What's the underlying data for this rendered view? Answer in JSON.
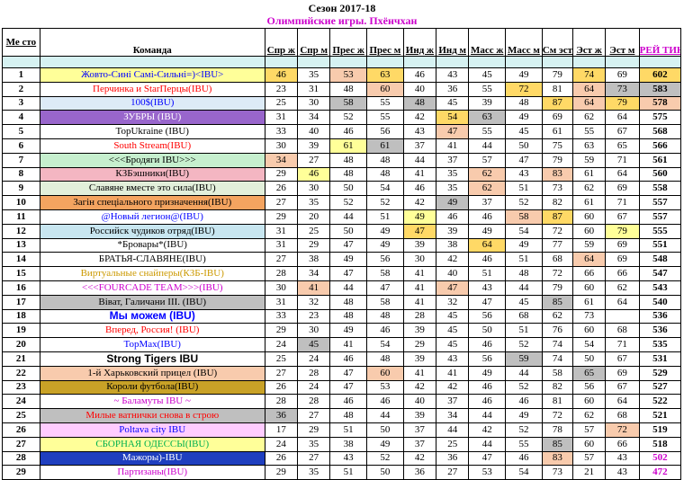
{
  "title": "Сезон 2017-18",
  "subtitle": "Олимпийские игры. Пхёнчхан",
  "headers": {
    "place": "Ме сто",
    "team": "Команда",
    "cols": [
      "Спр ж",
      "Спр м",
      "Прес ж",
      "Прес м",
      "Инд ж",
      "Инд м",
      "Масс ж",
      "Масс м",
      "См эст",
      "Эст ж",
      "Эст м"
    ],
    "rating": "РЕЙ ТИНГ"
  },
  "colors": {
    "yellow": "#ffff99",
    "peach": "#f8cbad",
    "gold": "#ffd966",
    "grey": "#bfbfbf",
    "light_blue": "#ddebf7",
    "spacer": "#d6f2f2"
  },
  "rows": [
    {
      "place": "1",
      "team": "Жовто-Сині Самі-Сильні=)<IBU>",
      "team_color": "#0000ff",
      "team_bg": "#ffff99",
      "team_bold": false,
      "values": [
        "46",
        "35",
        "53",
        "63",
        "46",
        "43",
        "45",
        "49",
        "79",
        "74",
        "69"
      ],
      "rating": "602",
      "rating_color": "#000000",
      "bg": [
        "#ffd966",
        "",
        "#f8cbad",
        "#ffd966",
        "",
        "",
        "",
        "",
        "",
        "#ffd966",
        ""
      ],
      "rating_bg": "#ffd966"
    },
    {
      "place": "2",
      "team": "Перчинка и StarПерцы(IBU)",
      "team_color": "#ff0000",
      "team_bg": "",
      "team_bold": false,
      "values": [
        "23",
        "31",
        "48",
        "60",
        "40",
        "36",
        "55",
        "72",
        "81",
        "64",
        "73"
      ],
      "rating": "583",
      "rating_color": "#000000",
      "bg": [
        "",
        "",
        "",
        "#f8cbad",
        "",
        "",
        "",
        "#ffd966",
        "",
        "#f8cbad",
        "#bfbfbf"
      ],
      "rating_bg": "#bfbfbf"
    },
    {
      "place": "3",
      "team": "100$(IBU)",
      "team_color": "#0000ff",
      "team_bg": "#ddebf7",
      "team_bold": false,
      "values": [
        "25",
        "30",
        "58",
        "55",
        "48",
        "45",
        "39",
        "48",
        "87",
        "64",
        "79"
      ],
      "rating": "578",
      "rating_color": "#000000",
      "bg": [
        "",
        "",
        "#bfbfbf",
        "",
        "#bfbfbf",
        "",
        "",
        "",
        "#ffd966",
        "#f8cbad",
        "#ffd966"
      ],
      "rating_bg": "#f8cbad"
    },
    {
      "place": "4",
      "team": "ЗУБРЫ (IBU)",
      "team_color": "#ffffff",
      "team_bg": "#9966cc",
      "team_bold": false,
      "values": [
        "31",
        "34",
        "52",
        "55",
        "42",
        "54",
        "63",
        "49",
        "69",
        "62",
        "64"
      ],
      "rating": "575",
      "rating_color": "#000000",
      "bg": [
        "",
        "",
        "",
        "",
        "",
        "#ffd966",
        "#bfbfbf",
        "",
        "",
        "",
        ""
      ],
      "rating_bg": ""
    },
    {
      "place": "5",
      "team": "TopUkraine (IBU)",
      "team_color": "#000000",
      "team_bg": "",
      "team_bold": false,
      "values": [
        "33",
        "40",
        "46",
        "56",
        "43",
        "47",
        "55",
        "45",
        "61",
        "55",
        "67"
      ],
      "rating": "568",
      "rating_color": "#000000",
      "bg": [
        "",
        "",
        "",
        "",
        "",
        "#f8cbad",
        "",
        "",
        "",
        "",
        ""
      ],
      "rating_bg": ""
    },
    {
      "place": "6",
      "team": "South Stream(IBU)",
      "team_color": "#ff0000",
      "team_bg": "",
      "team_bold": false,
      "values": [
        "30",
        "39",
        "61",
        "61",
        "37",
        "41",
        "44",
        "50",
        "75",
        "63",
        "65"
      ],
      "rating": "566",
      "rating_color": "#000000",
      "bg": [
        "",
        "",
        "#ffff99",
        "#bfbfbf",
        "",
        "",
        "",
        "",
        "",
        "",
        ""
      ],
      "rating_bg": ""
    },
    {
      "place": "7",
      "team": "<<<Бродяги IBU>>>",
      "team_color": "#000000",
      "team_bg": "#c6efce",
      "team_bold": false,
      "values": [
        "34",
        "27",
        "48",
        "48",
        "44",
        "37",
        "57",
        "47",
        "79",
        "59",
        "71"
      ],
      "rating": "561",
      "rating_color": "#000000",
      "bg": [
        "#f8cbad",
        "",
        "",
        "",
        "",
        "",
        "",
        "",
        "",
        "",
        ""
      ],
      "rating_bg": ""
    },
    {
      "place": "8",
      "team": "КЗБэшники(IBU)",
      "team_color": "#000000",
      "team_bg": "#f4b6c2",
      "team_bold": false,
      "values": [
        "29",
        "46",
        "48",
        "48",
        "41",
        "35",
        "62",
        "43",
        "83",
        "61",
        "64"
      ],
      "rating": "560",
      "rating_color": "#000000",
      "bg": [
        "",
        "#ffff99",
        "",
        "",
        "",
        "",
        "#f8cbad",
        "",
        "#f8cbad",
        "",
        ""
      ],
      "rating_bg": ""
    },
    {
      "place": "9",
      "team": "Славяне вместе это сила(IBU)",
      "team_color": "#000000",
      "team_bg": "#e2efda",
      "team_bold": false,
      "values": [
        "26",
        "30",
        "50",
        "54",
        "46",
        "35",
        "62",
        "51",
        "73",
        "62",
        "69"
      ],
      "rating": "558",
      "rating_color": "#000000",
      "bg": [
        "",
        "",
        "",
        "",
        "",
        "",
        "#f8cbad",
        "",
        "",
        "",
        ""
      ],
      "rating_bg": ""
    },
    {
      "place": "10",
      "team": "Загін спеціального призначення(IBU)",
      "team_color": "#000000",
      "team_bg": "#f4a460",
      "team_bold": false,
      "values": [
        "27",
        "35",
        "52",
        "52",
        "42",
        "49",
        "37",
        "52",
        "82",
        "61",
        "71"
      ],
      "rating": "557",
      "rating_color": "#000000",
      "bg": [
        "",
        "",
        "",
        "",
        "",
        "#bfbfbf",
        "",
        "",
        "",
        "",
        ""
      ],
      "rating_bg": ""
    },
    {
      "place": "11",
      "team": "@Новый легион@(IBU)",
      "team_color": "#0000ff",
      "team_bg": "",
      "team_bold": false,
      "values": [
        "29",
        "20",
        "44",
        "51",
        "49",
        "46",
        "46",
        "58",
        "87",
        "60",
        "67"
      ],
      "rating": "557",
      "rating_color": "#000000",
      "bg": [
        "",
        "",
        "",
        "",
        "#ffff99",
        "",
        "",
        "#f8cbad",
        "#ffd966",
        "",
        ""
      ],
      "rating_bg": ""
    },
    {
      "place": "12",
      "team": "Российск чудиков отряд(IBU)",
      "team_color": "#000000",
      "team_bg": "#c8e6f0",
      "team_bold": false,
      "values": [
        "31",
        "25",
        "50",
        "49",
        "47",
        "39",
        "49",
        "54",
        "72",
        "60",
        "79"
      ],
      "rating": "555",
      "rating_color": "#000000",
      "bg": [
        "",
        "",
        "",
        "",
        "#ffd966",
        "",
        "",
        "",
        "",
        "",
        "#ffff99"
      ],
      "rating_bg": ""
    },
    {
      "place": "13",
      "team": "*Бровары*(IBU)",
      "team_color": "#000000",
      "team_bg": "",
      "team_bold": false,
      "values": [
        "31",
        "29",
        "47",
        "49",
        "39",
        "38",
        "64",
        "49",
        "77",
        "59",
        "69"
      ],
      "rating": "551",
      "rating_color": "#000000",
      "bg": [
        "",
        "",
        "",
        "",
        "",
        "",
        "#ffd966",
        "",
        "",
        "",
        ""
      ],
      "rating_bg": ""
    },
    {
      "place": "14",
      "team": "БРАТЬЯ-СЛАВЯНЕ(IBU)",
      "team_color": "#000000",
      "team_bg": "",
      "team_bold": false,
      "values": [
        "27",
        "38",
        "49",
        "56",
        "30",
        "42",
        "46",
        "51",
        "68",
        "64",
        "69"
      ],
      "rating": "548",
      "rating_color": "#000000",
      "bg": [
        "",
        "",
        "",
        "",
        "",
        "",
        "",
        "",
        "",
        "#f8cbad",
        ""
      ],
      "rating_bg": ""
    },
    {
      "place": "15",
      "team": "Виртуальные снайперы(КЗБ-IBU)",
      "team_color": "#cc9900",
      "team_bg": "",
      "team_bold": false,
      "values": [
        "28",
        "34",
        "47",
        "58",
        "41",
        "40",
        "51",
        "48",
        "72",
        "66",
        "66"
      ],
      "rating": "547",
      "rating_color": "#000000",
      "bg": [
        "",
        "",
        "",
        "",
        "",
        "",
        "",
        "",
        "",
        "",
        ""
      ],
      "rating_bg": ""
    },
    {
      "place": "16",
      "team": "<<<FOURCADE TEAM>>>(IBU)",
      "team_color": "#cc00cc",
      "team_bg": "",
      "team_bold": false,
      "values": [
        "30",
        "41",
        "44",
        "47",
        "41",
        "47",
        "43",
        "44",
        "79",
        "60",
        "62"
      ],
      "rating": "543",
      "rating_color": "#000000",
      "bg": [
        "",
        "#f8cbad",
        "",
        "",
        "",
        "#f8cbad",
        "",
        "",
        "",
        "",
        ""
      ],
      "rating_bg": ""
    },
    {
      "place": "17",
      "team": "Віват, Галичани ІІІ. (IBU)",
      "team_color": "#000000",
      "team_bg": "#bfbfbf",
      "team_bold": false,
      "values": [
        "31",
        "32",
        "48",
        "58",
        "41",
        "32",
        "47",
        "45",
        "85",
        "61",
        "64"
      ],
      "rating": "540",
      "rating_color": "#000000",
      "bg": [
        "",
        "",
        "",
        "",
        "",
        "",
        "",
        "",
        "#bfbfbf",
        "",
        ""
      ],
      "rating_bg": ""
    },
    {
      "place": "18",
      "team": "Мы можем (IBU)",
      "team_color": "#0000ff",
      "team_bg": "",
      "team_bold": true,
      "values": [
        "33",
        "23",
        "48",
        "48",
        "28",
        "45",
        "56",
        "68",
        "62",
        "73",
        ""
      ],
      "rating": "536",
      "rating_color": "#000000",
      "bg": [
        "",
        "",
        "",
        "",
        "",
        "",
        "",
        "",
        "",
        "",
        ""
      ],
      "rating_bg": ""
    },
    {
      "place": "19",
      "team": "Вперед, Россия! (IBU)",
      "team_color": "#ff0000",
      "team_bg": "",
      "team_bold": false,
      "values": [
        "29",
        "30",
        "49",
        "46",
        "39",
        "45",
        "50",
        "51",
        "76",
        "60",
        "68"
      ],
      "rating": "536",
      "rating_color": "#000000",
      "bg": [
        "",
        "",
        "",
        "",
        "",
        "",
        "",
        "",
        "",
        "",
        ""
      ],
      "rating_bg": ""
    },
    {
      "place": "20",
      "team": "TopMax(IBU)",
      "team_color": "#0000ff",
      "team_bg": "",
      "team_bold": false,
      "values": [
        "24",
        "45",
        "41",
        "54",
        "29",
        "45",
        "46",
        "52",
        "74",
        "54",
        "71"
      ],
      "rating": "535",
      "rating_color": "#000000",
      "bg": [
        "",
        "#bfbfbf",
        "",
        "",
        "",
        "",
        "",
        "",
        "",
        "",
        ""
      ],
      "rating_bg": ""
    },
    {
      "place": "21",
      "team": "Strong Tigers IBU",
      "team_color": "#000000",
      "team_bg": "",
      "team_bold": true,
      "values": [
        "25",
        "24",
        "46",
        "48",
        "39",
        "43",
        "56",
        "59",
        "74",
        "50",
        "67"
      ],
      "rating": "531",
      "rating_color": "#000000",
      "bg": [
        "",
        "",
        "",
        "",
        "",
        "",
        "",
        "#bfbfbf",
        "",
        "",
        ""
      ],
      "rating_bg": ""
    },
    {
      "place": "22",
      "team": "1-й Харьковский прицел (IBU)",
      "team_color": "#000000",
      "team_bg": "#f8cbad",
      "team_bold": false,
      "values": [
        "27",
        "28",
        "47",
        "60",
        "41",
        "41",
        "49",
        "44",
        "58",
        "65",
        "69"
      ],
      "rating": "529",
      "rating_color": "#000000",
      "bg": [
        "",
        "",
        "",
        "#f8cbad",
        "",
        "",
        "",
        "",
        "",
        "#bfbfbf",
        ""
      ],
      "rating_bg": ""
    },
    {
      "place": "23",
      "team": "Короли футбола(IBU)",
      "team_color": "#000000",
      "team_bg": "#c9a227",
      "team_bold": false,
      "values": [
        "26",
        "24",
        "47",
        "53",
        "42",
        "42",
        "46",
        "52",
        "82",
        "56",
        "67"
      ],
      "rating": "527",
      "rating_color": "#000000",
      "bg": [
        "",
        "",
        "",
        "",
        "",
        "",
        "",
        "",
        "",
        "",
        ""
      ],
      "rating_bg": ""
    },
    {
      "place": "24",
      "team": "~ Баламуты IBU ~",
      "team_color": "#cc00cc",
      "team_bg": "",
      "team_bold": false,
      "values": [
        "28",
        "28",
        "46",
        "46",
        "40",
        "37",
        "46",
        "46",
        "81",
        "60",
        "64"
      ],
      "rating": "522",
      "rating_color": "#000000",
      "bg": [
        "",
        "",
        "",
        "",
        "",
        "",
        "",
        "",
        "",
        "",
        ""
      ],
      "rating_bg": ""
    },
    {
      "place": "25",
      "team": "Милые ватнички снова в строю",
      "team_color": "#ff0000",
      "team_bg": "#bfbfbf",
      "team_bold": false,
      "values": [
        "36",
        "27",
        "48",
        "44",
        "39",
        "34",
        "44",
        "49",
        "72",
        "62",
        "68"
      ],
      "rating": "521",
      "rating_color": "#000000",
      "bg": [
        "#bfbfbf",
        "",
        "",
        "",
        "",
        "",
        "",
        "",
        "",
        "",
        ""
      ],
      "rating_bg": ""
    },
    {
      "place": "26",
      "team": "Poltava city IBU",
      "team_color": "#0000ff",
      "team_bg": "#ffccff",
      "team_bold": false,
      "values": [
        "17",
        "29",
        "51",
        "50",
        "37",
        "44",
        "42",
        "52",
        "78",
        "57",
        "72"
      ],
      "rating": "519",
      "rating_color": "#000000",
      "bg": [
        "",
        "",
        "",
        "",
        "",
        "",
        "",
        "",
        "",
        "",
        "#f8cbad"
      ],
      "rating_bg": ""
    },
    {
      "place": "27",
      "team": "СБОРНАЯ ОДЕССЫ(IBU)",
      "team_color": "#00b050",
      "team_bg": "#ffff99",
      "team_bold": false,
      "values": [
        "24",
        "35",
        "38",
        "49",
        "37",
        "25",
        "44",
        "55",
        "85",
        "60",
        "66"
      ],
      "rating": "518",
      "rating_color": "#000000",
      "bg": [
        "",
        "",
        "",
        "",
        "",
        "",
        "",
        "",
        "#bfbfbf",
        "",
        ""
      ],
      "rating_bg": ""
    },
    {
      "place": "28",
      "team": "Мажоры)-IBU",
      "team_color": "#ffffff",
      "team_bg": "#1f3fbf",
      "team_bold": false,
      "values": [
        "26",
        "27",
        "43",
        "52",
        "42",
        "36",
        "47",
        "46",
        "83",
        "57",
        "43"
      ],
      "rating": "502",
      "rating_color": "#cc00cc",
      "bg": [
        "",
        "",
        "",
        "",
        "",
        "",
        "",
        "",
        "#f8cbad",
        "",
        ""
      ],
      "rating_bg": ""
    },
    {
      "place": "29",
      "team": "Партизаны(IBU)",
      "team_color": "#cc00cc",
      "team_bg": "",
      "team_bold": false,
      "values": [
        "29",
        "35",
        "51",
        "50",
        "36",
        "27",
        "53",
        "54",
        "73",
        "21",
        "43"
      ],
      "rating": "472",
      "rating_color": "#cc00cc",
      "bg": [
        "",
        "",
        "",
        "",
        "",
        "",
        "",
        "",
        "",
        "",
        ""
      ],
      "rating_bg": ""
    }
  ]
}
